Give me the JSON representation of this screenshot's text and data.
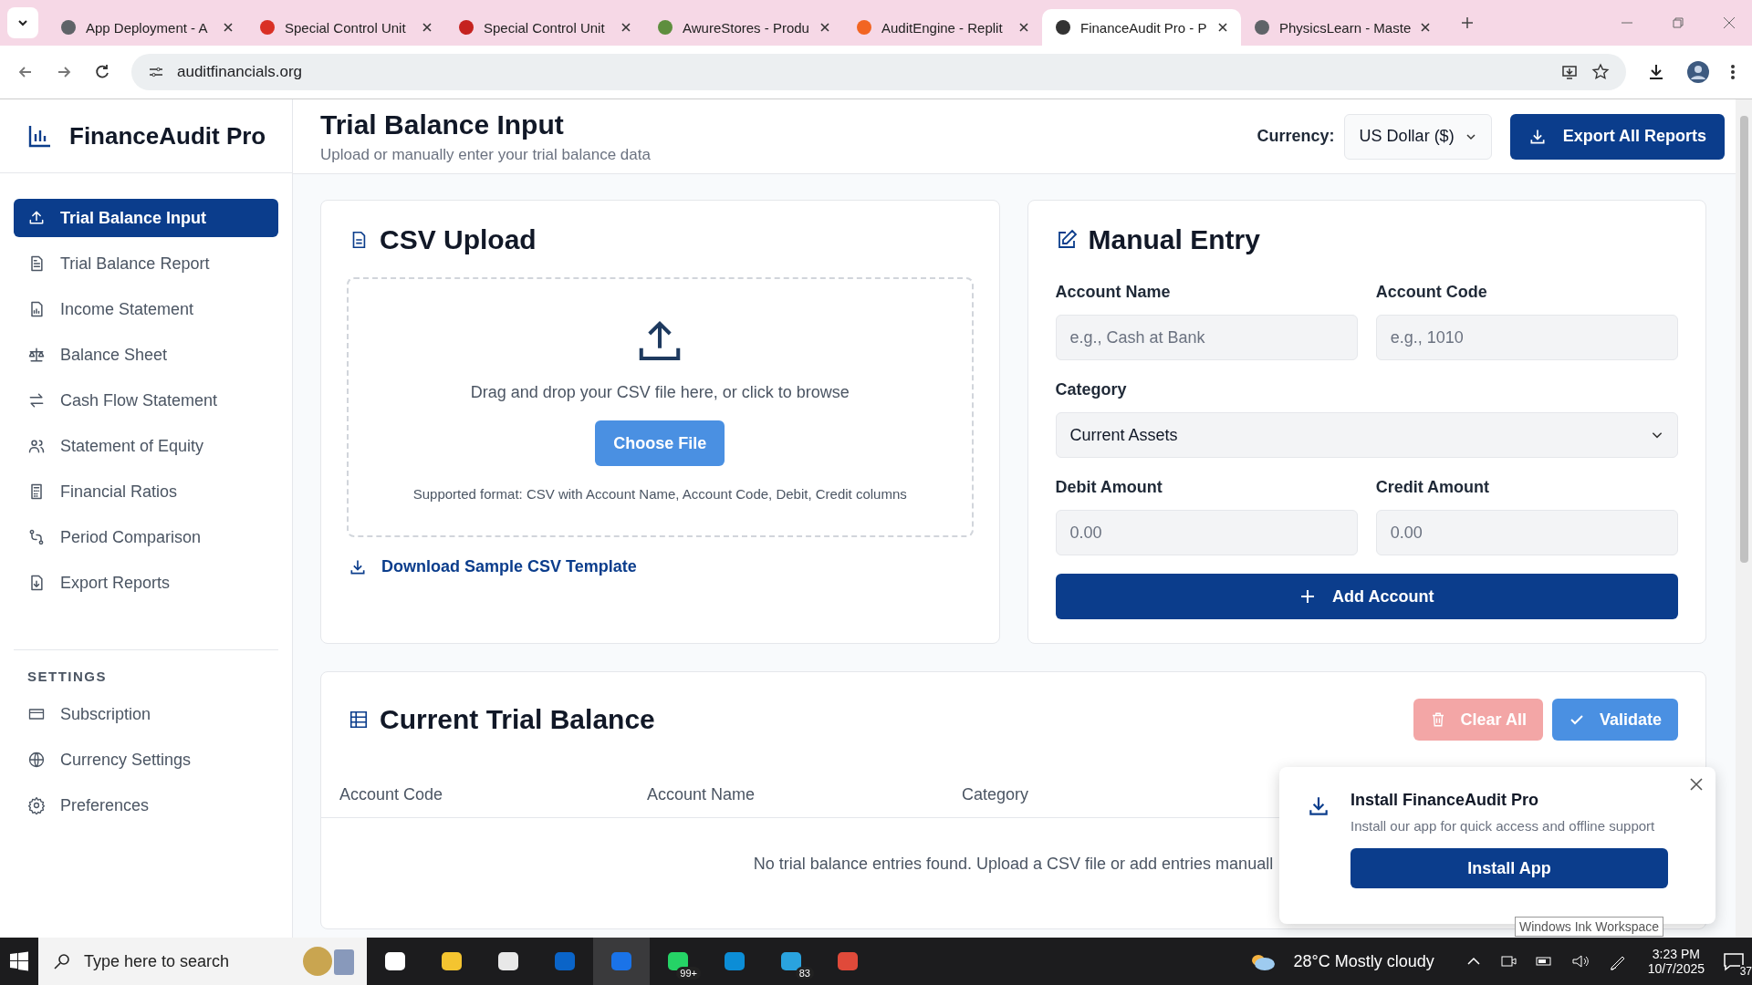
{
  "browser": {
    "tabs": [
      {
        "title": "App Deployment - A",
        "selected": false
      },
      {
        "title": "Special Control Unit",
        "selected": false
      },
      {
        "title": "Special Control Unit",
        "selected": false
      },
      {
        "title": "AwureStores - Produ",
        "selected": false
      },
      {
        "title": "AuditEngine - Replit",
        "selected": false
      },
      {
        "title": "FinanceAudit Pro - P",
        "selected": true
      },
      {
        "title": "PhysicsLearn - Maste",
        "selected": false
      }
    ],
    "address": "auditfinancials.org"
  },
  "sidebar": {
    "brand": "FinanceAudit Pro",
    "items": [
      {
        "label": "Trial Balance Input",
        "selected": true
      },
      {
        "label": "Trial Balance Report",
        "selected": false
      },
      {
        "label": "Income Statement",
        "selected": false
      },
      {
        "label": "Balance Sheet",
        "selected": false
      },
      {
        "label": "Cash Flow Statement",
        "selected": false
      },
      {
        "label": "Statement of Equity",
        "selected": false
      },
      {
        "label": "Financial Ratios",
        "selected": false
      },
      {
        "label": "Period Comparison",
        "selected": false
      },
      {
        "label": "Export Reports",
        "selected": false
      }
    ],
    "settings_heading": "SETTINGS",
    "settings_items": [
      {
        "label": "Subscription",
        "selected": false
      },
      {
        "label": "Currency Settings",
        "selected": false
      },
      {
        "label": "Preferences",
        "selected": false
      }
    ]
  },
  "header": {
    "title": "Trial Balance Input",
    "subtitle": "Upload or manually enter your trial balance data",
    "currency_label": "Currency:",
    "currency_value": "US Dollar ($)",
    "export_button": "Export All Reports"
  },
  "csv_upload": {
    "title": "CSV Upload",
    "drop_text": "Drag and drop your CSV file here, or click to browse",
    "choose_button": "Choose File",
    "format_note": "Supported format: CSV with Account Name, Account Code, Debit, Credit columns",
    "template_link": "Download Sample CSV Template"
  },
  "manual_entry": {
    "title": "Manual Entry",
    "fields": [
      {
        "kind": "text",
        "label": "Account Name",
        "placeholder": "e.g., Cash at Bank"
      },
      {
        "kind": "text",
        "label": "Account Code",
        "placeholder": "e.g., 1010"
      },
      {
        "kind": "select",
        "label": "Category",
        "value": "Current Assets"
      },
      {
        "kind": "text",
        "label": "Debit Amount",
        "placeholder": "0.00"
      },
      {
        "kind": "text",
        "label": "Credit Amount",
        "placeholder": "0.00"
      }
    ],
    "add_button": "Add Account"
  },
  "trial_balance": {
    "title": "Current Trial Balance",
    "clear_button": {
      "label": "Clear All",
      "disabled": true
    },
    "validate_button": "Validate",
    "columns": [
      "Account Code",
      "Account Name",
      "Category"
    ],
    "empty_message": "No trial balance entries found. Upload a CSV file or add entries manuall"
  },
  "install_prompt": {
    "title": "Install FinanceAudit Pro",
    "text": "Install our app for quick access and offline support",
    "button": "Install App"
  },
  "tooltip": "Windows Ink Workspace",
  "taskbar": {
    "search_placeholder": "Type here to search",
    "apps": [
      {
        "selected": false
      },
      {
        "selected": false
      },
      {
        "selected": false
      },
      {
        "selected": false
      },
      {
        "selected": true
      },
      {
        "selected": false,
        "badge": "99+"
      },
      {
        "selected": false
      },
      {
        "selected": false,
        "badge": "83"
      },
      {
        "selected": false
      }
    ],
    "weather": "28°C Mostly cloudy",
    "time": "3:23 PM",
    "date": "10/7/2025",
    "notifications": "37"
  }
}
